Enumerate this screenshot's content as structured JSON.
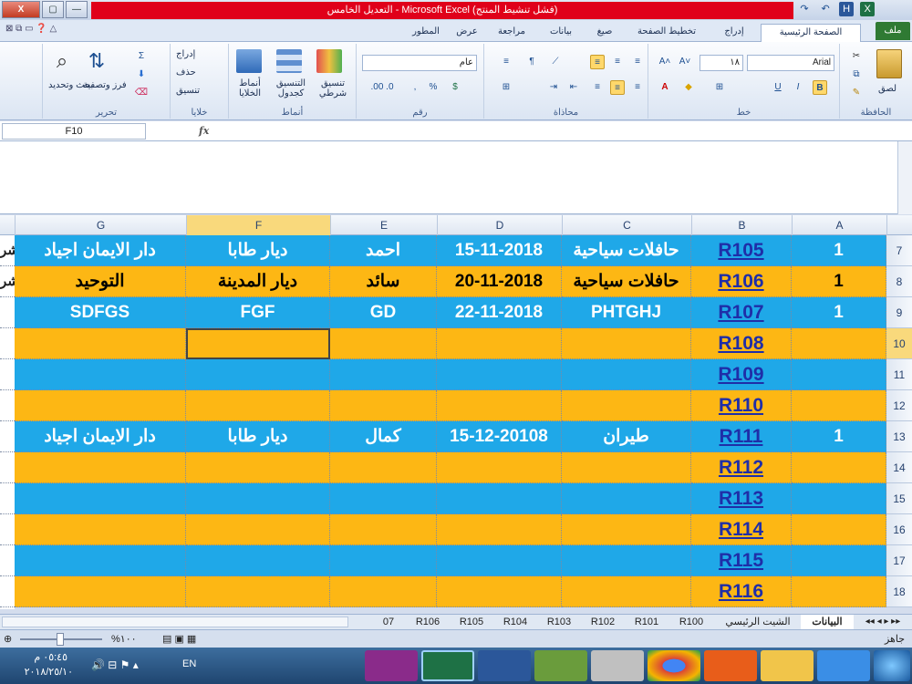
{
  "window": {
    "title": "التعديل الخامس - Microsoft Excel (فشل تنشيط المنتج)",
    "close": "X",
    "min": "—",
    "max": "▢"
  },
  "qat": {
    "save": "H",
    "undo": "↶",
    "redo": "↷"
  },
  "ribbon_tabs": [
    "ملف",
    "الصفحة الرئيسية",
    "إدراج",
    "تخطيط الصفحة",
    "صيغ",
    "بيانات",
    "مراجعة",
    "عرض",
    "المطور"
  ],
  "groups": {
    "clipboard": {
      "label": "الحافظة",
      "paste": "لصق"
    },
    "font": {
      "label": "خط",
      "name": "Arial",
      "size": "١٨",
      "bold": "B",
      "italic": "I",
      "underline": "U"
    },
    "alignment": {
      "label": "محاذاة"
    },
    "number": {
      "label": "رقم",
      "format": "عام"
    },
    "styles": {
      "label": "أنماط",
      "cond": "تنسيق شرطي",
      "table": "التنسيق كجدول",
      "cell": "أنماط الخلايا"
    },
    "cells": {
      "label": "خلايا",
      "insert": "إدراج",
      "delete": "حذف",
      "format": "تنسيق"
    },
    "editing": {
      "label": "تحرير",
      "sort": "فرز وتصفية",
      "find": "بحث وتحديد"
    }
  },
  "name_box": "F10",
  "fx": "fx",
  "columns": [
    "G",
    "F",
    "E",
    "D",
    "C",
    "B",
    "A"
  ],
  "rows": [
    {
      "n": "7",
      "G": "دار الايمان اجياد",
      "F": "ديار طابا",
      "E": "احمد",
      "D": "15-11-2018",
      "C": "حافلات سياحية",
      "B": "R105",
      "A": "1",
      "left": "شر"
    },
    {
      "n": "8",
      "G": "التوحيد",
      "F": "ديار المدينة",
      "E": "سائد",
      "D": "20-11-2018",
      "C": "حافلات سياحية",
      "B": "R106",
      "A": "1",
      "left": "شر"
    },
    {
      "n": "9",
      "G": "SDFGS",
      "F": "FGF",
      "E": "GD",
      "D": "22-11-2018",
      "C": "PHTGHJ",
      "B": "R107",
      "A": "1",
      "left": ""
    },
    {
      "n": "10",
      "G": "",
      "F": "",
      "E": "",
      "D": "",
      "C": "",
      "B": "R108",
      "A": "",
      "left": ""
    },
    {
      "n": "11",
      "G": "",
      "F": "",
      "E": "",
      "D": "",
      "C": "",
      "B": "R109",
      "A": "",
      "left": ""
    },
    {
      "n": "12",
      "G": "",
      "F": "",
      "E": "",
      "D": "",
      "C": "",
      "B": "R110",
      "A": "",
      "left": ""
    },
    {
      "n": "13",
      "G": "دار الايمان اجياد",
      "F": "ديار طابا",
      "E": "كمال",
      "D": "15-12-20108",
      "C": "طيران",
      "B": "R111",
      "A": "1",
      "left": ""
    },
    {
      "n": "14",
      "G": "",
      "F": "",
      "E": "",
      "D": "",
      "C": "",
      "B": "R112",
      "A": "",
      "left": ""
    },
    {
      "n": "15",
      "G": "",
      "F": "",
      "E": "",
      "D": "",
      "C": "",
      "B": "R113",
      "A": "",
      "left": ""
    },
    {
      "n": "16",
      "G": "",
      "F": "",
      "E": "",
      "D": "",
      "C": "",
      "B": "R114",
      "A": "",
      "left": ""
    },
    {
      "n": "17",
      "G": "",
      "F": "",
      "E": "",
      "D": "",
      "C": "",
      "B": "R115",
      "A": "",
      "left": ""
    },
    {
      "n": "18",
      "G": "",
      "F": "",
      "E": "",
      "D": "",
      "C": "",
      "B": "R116",
      "A": "",
      "left": ""
    }
  ],
  "row_colors": [
    "#1fa8e8",
    "#fdb714",
    "#1fa8e8",
    "#fdb714",
    "#1fa8e8",
    "#fdb714",
    "#1fa8e8",
    "#fdb714",
    "#1fa8e8",
    "#fdb714",
    "#1fa8e8",
    "#fdb714"
  ],
  "sheet_tabs": [
    "البيانات",
    "الشيت الرئيسي",
    "R100",
    "R101",
    "R102",
    "R103",
    "R104",
    "R105",
    "R106",
    "07"
  ],
  "status": {
    "ready": "جاهز",
    "zoom": "%١٠٠"
  },
  "taskbar": {
    "time": "٠٥:٤٥ م",
    "date": "٢٠١٨/٢٥/١٠",
    "lang": "EN"
  }
}
